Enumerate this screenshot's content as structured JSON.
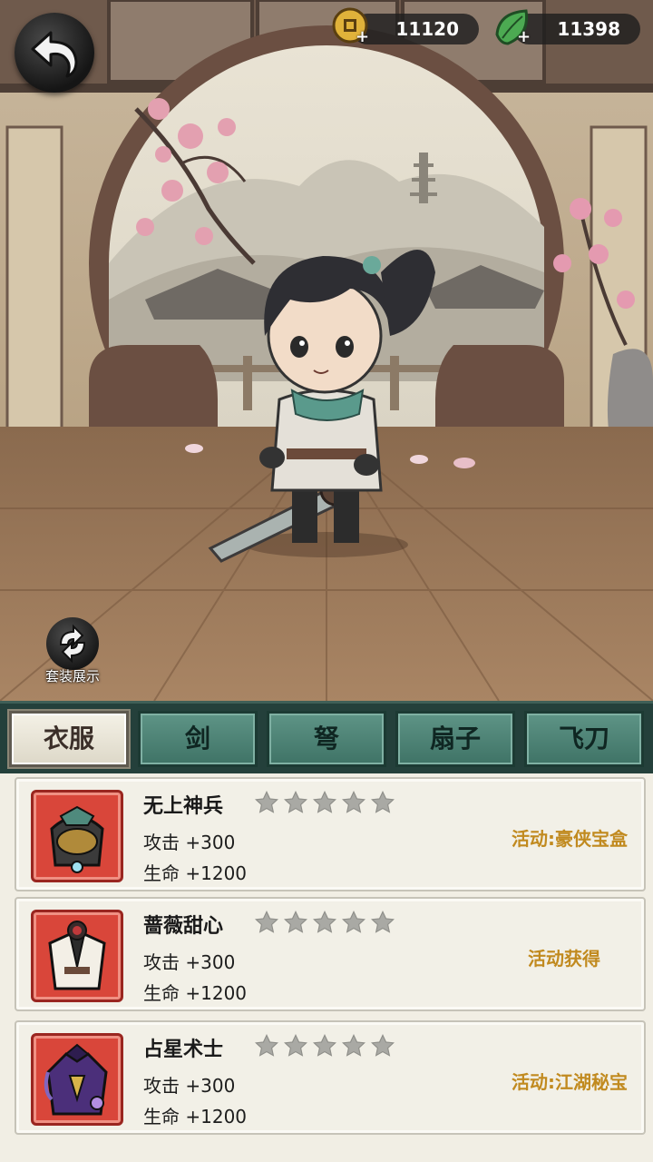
{
  "hud": {
    "coins": "11120",
    "leaves": "11398",
    "suit_label": "套装展示"
  },
  "tabs": [
    "衣服",
    "剑",
    "弩",
    "扇子",
    "飞刀"
  ],
  "active_tab": 0,
  "items": [
    {
      "name": "无上神兵",
      "attack": "攻击 +300",
      "hp": "生命 +1200",
      "stars": 0,
      "source": "活动:豪侠宝盒"
    },
    {
      "name": "蔷薇甜心",
      "attack": "攻击 +300",
      "hp": "生命 +1200",
      "stars": 0,
      "source": "活动获得"
    },
    {
      "name": "占星术士",
      "attack": "攻击 +300",
      "hp": "生命 +1200",
      "stars": 0,
      "source": "活动:江湖秘宝"
    }
  ]
}
